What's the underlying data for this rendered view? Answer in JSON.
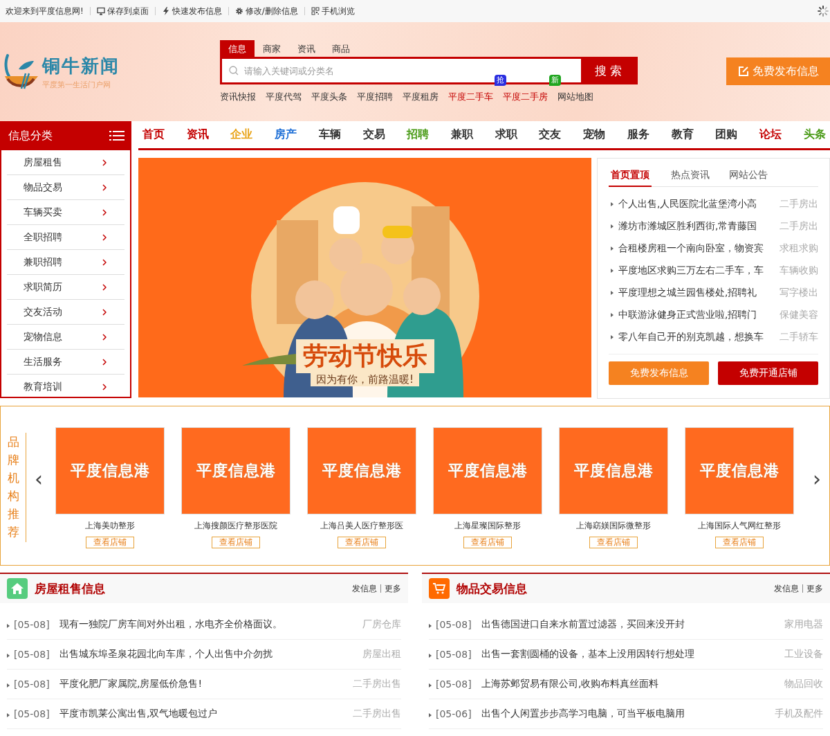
{
  "top_bar": {
    "welcome": "欢迎来到平度信息网!",
    "links": [
      {
        "kind": "desktop",
        "label": "保存到桌面"
      },
      {
        "kind": "bolt",
        "label": "快速发布信息"
      },
      {
        "kind": "gear",
        "label": "修改/删除信息"
      },
      {
        "kind": "qr",
        "label": "手机浏览"
      }
    ]
  },
  "header": {
    "logo_title": "铜牛新闻",
    "logo_subtitle": "平度第一生活门户网",
    "search_tabs": [
      {
        "label": "信息",
        "selected": true
      },
      {
        "label": "商家",
        "selected": false
      },
      {
        "label": "资讯",
        "selected": false
      },
      {
        "label": "商品",
        "selected": false
      }
    ],
    "search": {
      "placeholder": "请输入关键词或分类名",
      "button": "搜 索"
    },
    "hot_links": [
      {
        "label": "资讯快报",
        "highlighted": false
      },
      {
        "label": "平度代驾",
        "highlighted": false
      },
      {
        "label": "平度头条",
        "highlighted": false
      },
      {
        "label": "平度招聘",
        "highlighted": false
      },
      {
        "label": "平度租房",
        "highlighted": false
      },
      {
        "label": "平度二手车",
        "highlighted": true
      },
      {
        "label": "平度二手房",
        "highlighted": true,
        "badge": "抢",
        "color": "#2a2ee0"
      },
      {
        "label": "网站地图",
        "highlighted": false,
        "badge": "新",
        "color": "#1fa51f"
      }
    ],
    "publish_button": "免费发布信息"
  },
  "sidebar": {
    "title": "信息分类",
    "items": [
      "房屋租售",
      "物品交易",
      "车辆买卖",
      "全职招聘",
      "兼职招聘",
      "求职简历",
      "交友活动",
      "宠物信息",
      "生活服务",
      "教育培训"
    ]
  },
  "nav": [
    {
      "label": "首页",
      "color": "#c40000"
    },
    {
      "label": "资讯",
      "color": "#c40000"
    },
    {
      "label": "企业",
      "color": "#e8a317"
    },
    {
      "label": "房产",
      "color": "#1c6ed6"
    },
    {
      "label": "车辆",
      "color": "#333333"
    },
    {
      "label": "交易",
      "color": "#333333"
    },
    {
      "label": "招聘",
      "color": "#4c9c1a"
    },
    {
      "label": "兼职",
      "color": "#333333"
    },
    {
      "label": "求职",
      "color": "#333333"
    },
    {
      "label": "交友",
      "color": "#333333"
    },
    {
      "label": "宠物",
      "color": "#333333"
    },
    {
      "label": "服务",
      "color": "#333333"
    },
    {
      "label": "教育",
      "color": "#333333"
    },
    {
      "label": "团购",
      "color": "#333333"
    },
    {
      "label": "论坛",
      "color": "#c40000"
    },
    {
      "label": "头条",
      "color": "#4c9c1a"
    }
  ],
  "banner": {
    "kind": "picture",
    "title": "劳动节快乐",
    "subtitle": "因为有你，前路温暖!"
  },
  "notice_panel": {
    "tabs": [
      {
        "label": "首页置顶",
        "selected": true
      },
      {
        "label": "热点资讯",
        "selected": false
      },
      {
        "label": "网站公告",
        "selected": false
      }
    ],
    "items": [
      {
        "title": "个人出售,人民医院北蓝堡湾小高",
        "category": "二手房出"
      },
      {
        "title": "潍坊市潍城区胜利西街,常青藤国",
        "category": "二手房出"
      },
      {
        "title": "合租楼房租一个南向卧室，物资宾",
        "category": "求租求购"
      },
      {
        "title": "平度地区求购三万左右二手车，车",
        "category": "车辆收购"
      },
      {
        "title": "平度理想之城兰园售楼处,招聘礼",
        "category": "写字楼出"
      },
      {
        "title": "中联游泳健身正式营业啦,招聘门",
        "category": "保健美容"
      },
      {
        "title": "零八年自己开的别克凯越，想换车",
        "category": "二手轿车"
      }
    ],
    "buttons": [
      "免费发布信息",
      "免费开通店铺"
    ]
  },
  "brands": {
    "title": "品牌机构推荐",
    "prev": "‹",
    "next": "›",
    "items": [
      {
        "logo_text": "平度信息港",
        "name": "上海美叻整形",
        "button": "查看店铺"
      },
      {
        "logo_text": "平度信息港",
        "name": "上海搜颜医疗整形医院",
        "button": "查看店铺"
      },
      {
        "logo_text": "平度信息港",
        "name": "上海吕美人医疗整形医",
        "button": "查看店铺"
      },
      {
        "logo_text": "平度信息港",
        "name": "上海星璨国际整形",
        "button": "查看店铺"
      },
      {
        "logo_text": "平度信息港",
        "name": "上海窈媄国际微整形",
        "button": "查看店铺"
      },
      {
        "logo_text": "平度信息港",
        "name": "上海国际人气网红整形",
        "button": "查看店铺"
      }
    ]
  },
  "sections": [
    {
      "kind": "house",
      "title": "房屋租售信息",
      "post": "发信息",
      "more": "更多",
      "rows": [
        {
          "date": "[05-08]",
          "title": "现有一独院厂房车间对外出租，水电齐全价格面议。",
          "category": "厂房仓库"
        },
        {
          "date": "[05-08]",
          "title": "出售城东埠圣泉花园北向车库，个人出售中介勿扰",
          "category": "房屋出租"
        },
        {
          "date": "[05-08]",
          "title": "平度化肥厂家属院,房屋低价急售!",
          "category": "二手房出售"
        },
        {
          "date": "[05-08]",
          "title": "平度市凯莱公寓出售,双气地暖包过户",
          "category": "二手房出售"
        }
      ]
    },
    {
      "kind": "cart",
      "title": "物品交易信息",
      "post": "发信息",
      "more": "更多",
      "rows": [
        {
          "date": "[05-08]",
          "title": "出售德国进口自来水前置过滤器，买回来没开封",
          "category": "家用电器"
        },
        {
          "date": "[05-08]",
          "title": "出售一套割圆桶的设备，基本上没用因转行想处理",
          "category": "工业设备"
        },
        {
          "date": "[05-08]",
          "title": "上海苏邺贸易有限公司,收购布料真丝面料",
          "category": "物品回收"
        },
        {
          "date": "[05-06]",
          "title": "出售个人闲置步步高学习电脑，可当平板电脑用",
          "category": "手机及配件"
        }
      ]
    }
  ]
}
